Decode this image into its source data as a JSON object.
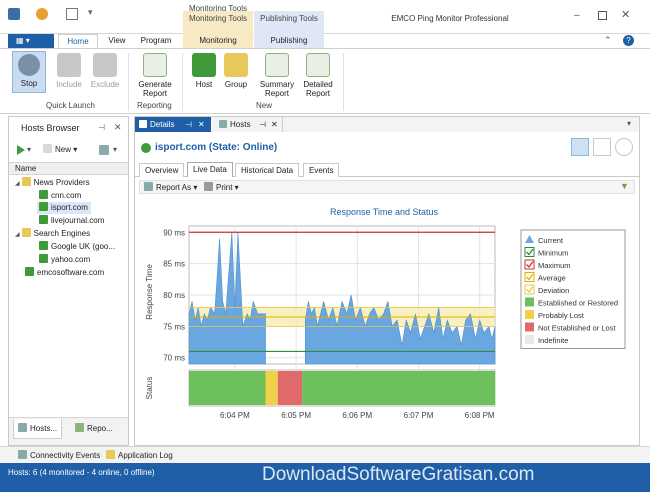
{
  "window": {
    "title": "EMCO Ping Monitor Professional",
    "context_tools": [
      "Monitoring Tools",
      "Publishing Tools"
    ]
  },
  "ribbon": {
    "tabs": [
      "Home",
      "View",
      "Program",
      "Monitoring",
      "Publishing"
    ],
    "active_tab": "Home",
    "groups": [
      {
        "label": "Quick Launch",
        "buttons": [
          "Stop",
          "Include",
          "Exclude"
        ]
      },
      {
        "label": "Reporting",
        "buttons": [
          "Generate Report"
        ]
      },
      {
        "label": "New",
        "buttons": [
          "Host",
          "Group",
          "Summary Report",
          "Detailed Report"
        ]
      }
    ]
  },
  "hosts_browser": {
    "title": "Hosts Browser",
    "new_label": "New",
    "column": "Name",
    "tree": [
      {
        "level": 0,
        "label": "News Providers",
        "kind": "folder"
      },
      {
        "level": 1,
        "label": "cnn.com",
        "kind": "host"
      },
      {
        "level": 1,
        "label": "isport.com",
        "kind": "host",
        "selected": true
      },
      {
        "level": 1,
        "label": "livejournal.com",
        "kind": "host"
      },
      {
        "level": 0,
        "label": "Search Engines",
        "kind": "folder"
      },
      {
        "level": 1,
        "label": "Google UK (goo...",
        "kind": "host"
      },
      {
        "level": 1,
        "label": "yahoo.com",
        "kind": "host"
      },
      {
        "level": 0,
        "label": "emcosoftware.com",
        "kind": "host"
      }
    ],
    "bottom_tabs": [
      "Hosts...",
      "Repo..."
    ]
  },
  "doc_tabs": [
    "Details",
    "Hosts"
  ],
  "details": {
    "host_title": "isport.com (State: Online)",
    "subtabs": [
      "Overview",
      "Live Data",
      "Historical Data",
      "Events"
    ],
    "active_subtab": "Live Data",
    "report_as": "Report As",
    "print": "Print"
  },
  "chart_data": {
    "type": "area",
    "title": "Response Time and Status",
    "ylabel": "Response Time",
    "status_label": "Status",
    "ylim": [
      69,
      91
    ],
    "y_ticks": [
      "90 ms",
      "85 ms",
      "80 ms",
      "75 ms",
      "70 ms"
    ],
    "y_tick_values": [
      90,
      85,
      80,
      75,
      70
    ],
    "x_ticks": [
      "6:04 PM",
      "6:05 PM",
      "6:06 PM",
      "6:07 PM",
      "6:08 PM"
    ],
    "x_tick_minutes": [
      0.75,
      1.75,
      2.75,
      3.75,
      4.75
    ],
    "xlim_minutes": [
      0,
      5
    ],
    "maximum": 90,
    "minimum": 71,
    "average": 76.5,
    "deviation_band": [
      75,
      78
    ],
    "series": [
      {
        "name": "Current",
        "points": [
          [
            0.0,
            77
          ],
          [
            0.05,
            79
          ],
          [
            0.1,
            76
          ],
          [
            0.15,
            78
          ],
          [
            0.2,
            75
          ],
          [
            0.25,
            77
          ],
          [
            0.3,
            76
          ],
          [
            0.35,
            78
          ],
          [
            0.42,
            77
          ],
          [
            0.5,
            89
          ],
          [
            0.55,
            79
          ],
          [
            0.6,
            77
          ],
          [
            0.7,
            90
          ],
          [
            0.75,
            78
          ],
          [
            0.8,
            90
          ],
          [
            0.88,
            75
          ],
          [
            0.95,
            77
          ],
          [
            1.0,
            76
          ],
          [
            1.05,
            79
          ],
          [
            1.12,
            77
          ],
          [
            1.25,
            77
          ],
          [
            1.25,
            null
          ],
          [
            1.9,
            null
          ],
          [
            1.9,
            76
          ],
          [
            1.95,
            79
          ],
          [
            2.0,
            77
          ],
          [
            2.05,
            78
          ],
          [
            2.1,
            75
          ],
          [
            2.15,
            77
          ],
          [
            2.2,
            79
          ],
          [
            2.28,
            76
          ],
          [
            2.35,
            78
          ],
          [
            2.42,
            75
          ],
          [
            2.5,
            79
          ],
          [
            2.58,
            77
          ],
          [
            2.65,
            80
          ],
          [
            2.72,
            76
          ],
          [
            2.8,
            78
          ],
          [
            2.88,
            75
          ],
          [
            2.95,
            77
          ],
          [
            3.02,
            78
          ],
          [
            3.1,
            76
          ],
          [
            3.18,
            77
          ],
          [
            3.25,
            79
          ],
          [
            3.32,
            75
          ],
          [
            3.4,
            76
          ],
          [
            3.48,
            72
          ],
          [
            3.55,
            76
          ],
          [
            3.62,
            74
          ],
          [
            3.7,
            77
          ],
          [
            3.78,
            73
          ],
          [
            3.85,
            75
          ],
          [
            3.92,
            77
          ],
          [
            4.0,
            74
          ],
          [
            4.08,
            78
          ],
          [
            4.15,
            73
          ],
          [
            4.22,
            76
          ],
          [
            4.3,
            74
          ],
          [
            4.38,
            75
          ],
          [
            4.45,
            72
          ],
          [
            4.52,
            76
          ],
          [
            4.6,
            77
          ],
          [
            4.68,
            73
          ],
          [
            4.75,
            76
          ],
          [
            4.82,
            74
          ],
          [
            4.9,
            75
          ],
          [
            4.95,
            73
          ],
          [
            5.0,
            75
          ]
        ]
      }
    ],
    "status_segments": [
      {
        "from": 0.0,
        "to": 1.25,
        "state": "Established or Restored"
      },
      {
        "from": 1.25,
        "to": 1.45,
        "state": "Probably Lost"
      },
      {
        "from": 1.45,
        "to": 1.85,
        "state": "Not Established or Lost"
      },
      {
        "from": 1.85,
        "to": 5.0,
        "state": "Established or Restored"
      }
    ],
    "legend": [
      {
        "name": "Current",
        "color": "#6aa6e0",
        "glyph": "triangle"
      },
      {
        "name": "Minimum",
        "color": "#2e8b3a",
        "glyph": "check"
      },
      {
        "name": "Maximum",
        "color": "#c33",
        "glyph": "check"
      },
      {
        "name": "Average",
        "color": "#e0b000",
        "glyph": "check"
      },
      {
        "name": "Deviation",
        "color": "#e8c84a",
        "glyph": "check"
      },
      {
        "name": "Established or Restored",
        "color": "#6dbf5b",
        "glyph": "box"
      },
      {
        "name": "Probably Lost",
        "color": "#f0d24a",
        "glyph": "box"
      },
      {
        "name": "Not Established or Lost",
        "color": "#e06a6a",
        "glyph": "box"
      },
      {
        "name": "Indefinite",
        "color": "#e8e8e8",
        "glyph": "box"
      }
    ]
  },
  "bottom_bar": {
    "tabs": [
      "Connectivity Events",
      "Application Log"
    ],
    "status": "Hosts: 6 (4 monitored - 4 online, 0 offline)",
    "watermark": "DownloadSoftwareGratisan.com"
  },
  "colors": {
    "accent": "#1e5fa7",
    "monitoring_tab": "#f6e9c4",
    "publishing_tab": "#dfe6f5",
    "area_fill": "#6aa6e0"
  }
}
